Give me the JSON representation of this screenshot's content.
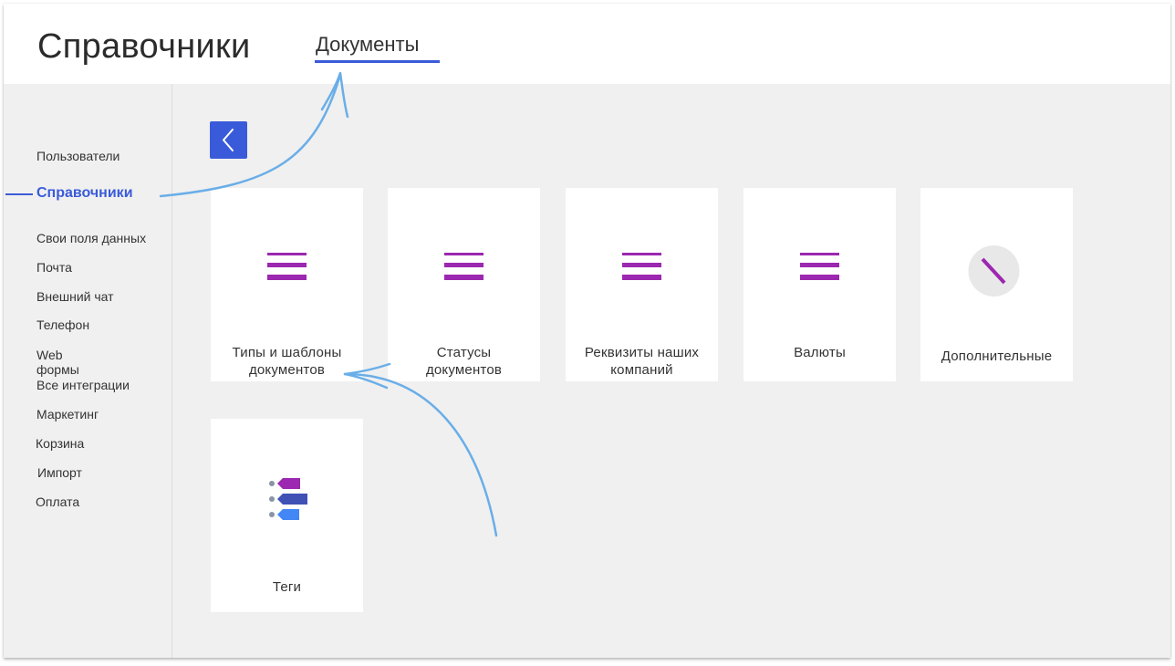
{
  "header": {
    "title": "Справочники",
    "tab_label": "Документы"
  },
  "sidebar": {
    "items": [
      {
        "label": "Пользователи"
      },
      {
        "label": "Справочники",
        "active": true
      },
      {
        "label": "Свои поля данных"
      },
      {
        "label": "Почта"
      },
      {
        "label": "Внешний чат"
      },
      {
        "label": "Телефон"
      },
      {
        "label": "Web"
      },
      {
        "label": "формы"
      },
      {
        "label": "Все интеграции"
      },
      {
        "label": "Маркетинг"
      },
      {
        "label": "Корзина"
      },
      {
        "label": "Импорт"
      },
      {
        "label": "Оплата"
      }
    ]
  },
  "cards": [
    {
      "label_line1": "Типы и шаблоны",
      "label_line2": "документов",
      "icon": "list-icon"
    },
    {
      "label_line1": "Статусы",
      "label_line2": "документов",
      "icon": "list-icon"
    },
    {
      "label_line1": "Реквизиты наших",
      "label_line2": "компаний",
      "icon": "list-icon"
    },
    {
      "label_line1": "Валюты",
      "icon": "list-icon"
    },
    {
      "label_line1": "Дополнительные",
      "icon": "slash-circle-icon"
    },
    {
      "label_line1": "Теги",
      "icon": "tags-icon"
    }
  ],
  "colors": {
    "accent": "#3a5bd9",
    "icon_purple": "#9c27b0",
    "arrow": "#6aaee8",
    "background": "#f0f0f0"
  }
}
